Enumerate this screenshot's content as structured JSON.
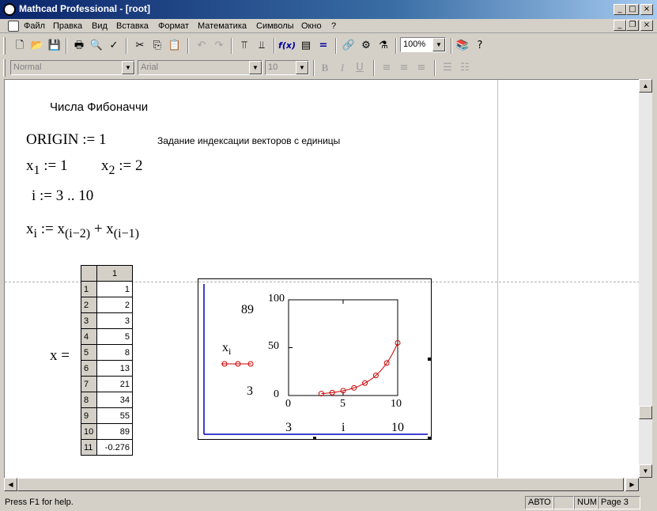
{
  "window": {
    "title": "Mathcad Professional - [root]"
  },
  "menu": [
    "Файл",
    "Правка",
    "Вид",
    "Вставка",
    "Формат",
    "Математика",
    "Символы",
    "Окно",
    "?"
  ],
  "toolbar": {
    "zoom": "100%",
    "style": "Normal",
    "font": "Arial",
    "size": "10"
  },
  "doc": {
    "heading": "Числа Фибоначчи",
    "origin_expr": "ORIGIN := 1",
    "origin_note": "Задание индексации векторов с единицы",
    "x1_base": "x",
    "x1_sub": "1",
    "x1_rest": " := 1",
    "x2_base": "x",
    "x2_sub": "2",
    "x2_rest": " := 2",
    "range_expr": "i := 3 .. 10",
    "rec_lhs_base": "x",
    "rec_lhs_sub": "i",
    "rec_mid": " := x",
    "rec_sub1": "(i−2)",
    "rec_plus": " + x",
    "rec_sub2": "(i−1)",
    "matrix_label": "x =",
    "matrix_col_header": "1",
    "matrix_rows": [
      "1",
      "2",
      "3",
      "4",
      "5",
      "6",
      "7",
      "8",
      "9",
      "10",
      "11"
    ],
    "matrix_values": [
      "1",
      "2",
      "3",
      "5",
      "8",
      "13",
      "21",
      "34",
      "55",
      "89",
      "-0.276"
    ]
  },
  "chart_data": {
    "type": "line",
    "series": [
      {
        "name": "x",
        "x": [
          3,
          4,
          5,
          6,
          7,
          8,
          9,
          10
        ],
        "y": [
          2,
          3,
          5,
          8,
          13,
          21,
          34,
          55
        ]
      }
    ],
    "xlim": [
      0,
      10
    ],
    "ylim": [
      0,
      100
    ],
    "x_ticks": [
      "0",
      "5",
      "10"
    ],
    "y_ticks": [
      "0",
      "50",
      "100"
    ],
    "y_axis_var_base": "x",
    "y_axis_var_sub": "i",
    "y_top_label": "89",
    "y_bottom_label": "3",
    "x_axis_var": "i",
    "x_left_label": "3",
    "x_right_label": "10",
    "color": "#cc0000"
  },
  "status": {
    "help": "Press F1 for help.",
    "mode": "АВТО",
    "num": "NUM",
    "page": "Page 3"
  }
}
